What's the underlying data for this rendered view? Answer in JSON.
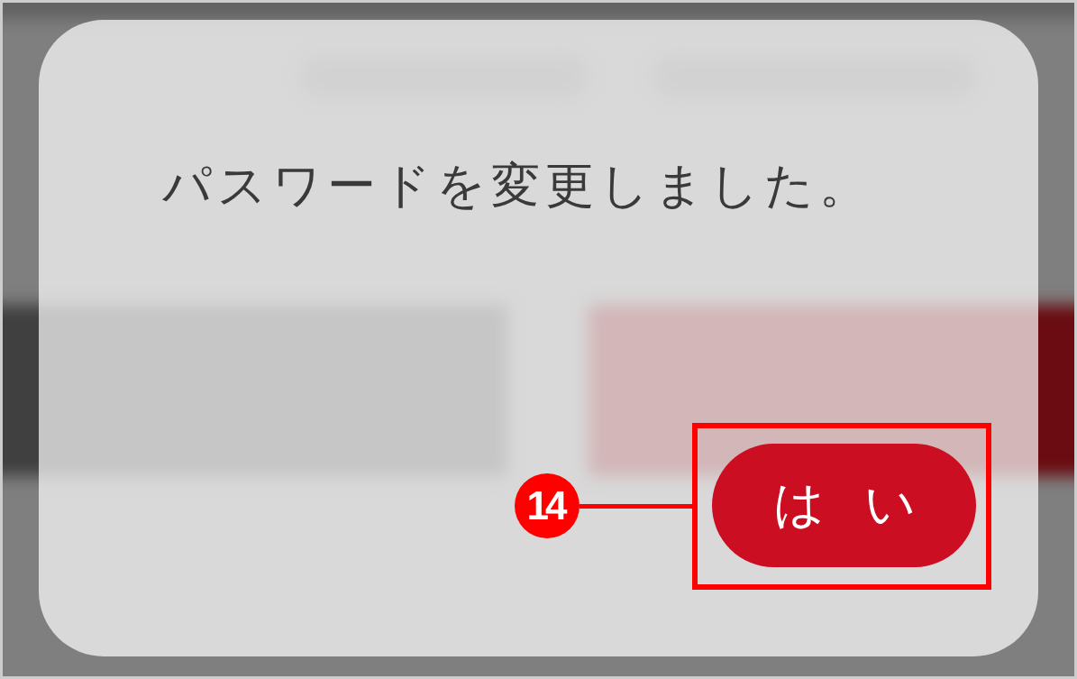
{
  "dialog": {
    "message": "パスワードを変更しました。",
    "confirm_button": {
      "label": "はい"
    }
  },
  "annotation": {
    "number": "14"
  }
}
